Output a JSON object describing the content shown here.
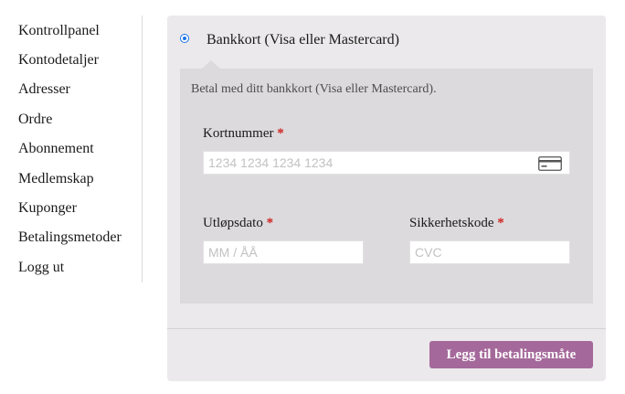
{
  "sidebar": {
    "items": [
      {
        "label": "Kontrollpanel"
      },
      {
        "label": "Kontodetaljer"
      },
      {
        "label": "Adresser"
      },
      {
        "label": "Ordre"
      },
      {
        "label": "Abonnement"
      },
      {
        "label": "Medlemskap"
      },
      {
        "label": "Kuponger"
      },
      {
        "label": "Betalingsmetoder"
      },
      {
        "label": "Logg ut"
      }
    ]
  },
  "payment": {
    "method_label": "Bankkort (Visa eller Mastercard)",
    "method_selected": true,
    "description": "Betal med ditt bankkort (Visa eller Mastercard).",
    "required_marker": "*",
    "card_number": {
      "label": "Kortnummer",
      "placeholder": "1234 1234 1234 1234",
      "value": ""
    },
    "expiry": {
      "label": "Utløpsdato",
      "placeholder": "MM / ÅÅ",
      "value": ""
    },
    "cvc": {
      "label": "Sikkerhetskode",
      "placeholder": "CVC",
      "value": ""
    },
    "submit_label": "Legg til betalingsmåte"
  },
  "icons": {
    "card": "credit-card-icon"
  },
  "colors": {
    "accent_button": "#a4699a",
    "radio_selected": "#1e73e8",
    "required": "#d01f1f",
    "panel_bg": "#ebe9eb",
    "box_bg": "#dcdadc"
  }
}
